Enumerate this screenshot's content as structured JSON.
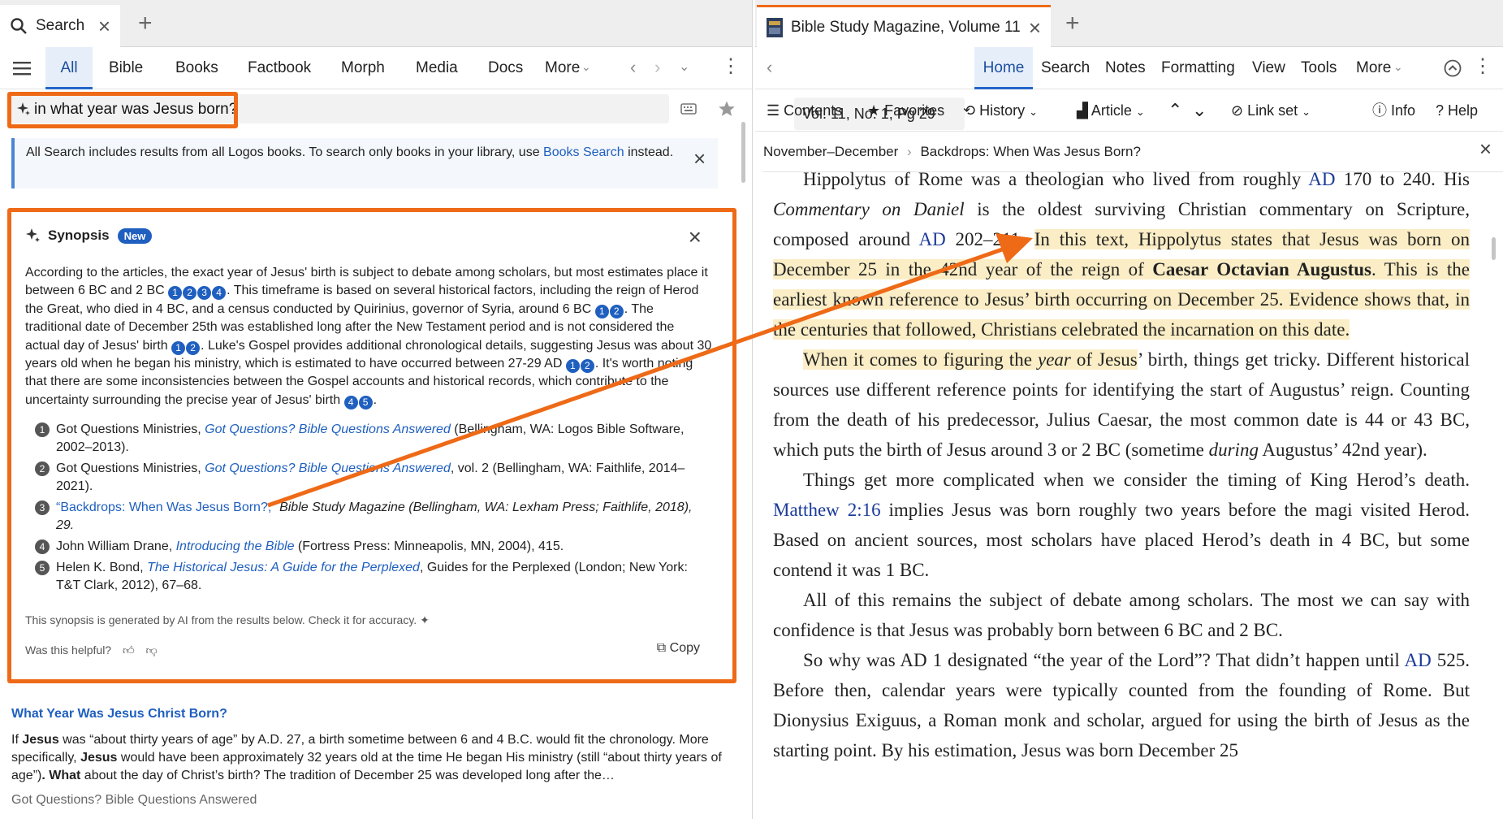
{
  "left": {
    "tab": {
      "label": "Search"
    },
    "nav": {
      "items": [
        "All",
        "Bible",
        "Books",
        "Factbook",
        "Morph",
        "Media",
        "Docs",
        "More"
      ]
    },
    "query": "in what year was Jesus born?",
    "info": {
      "text": "All Search includes results from all Logos books. To search only books in your library, use ",
      "link": "Books Search",
      "tail": " instead."
    },
    "synopsis": {
      "title": "Synopsis",
      "badge": "New",
      "p1": "According to the articles, the exact year of Jesus' birth is subject to debate among scholars, but most estimates place it between 6 BC and 2 BC",
      "p2": ". This timeframe is based on several historical factors, including the reign of Herod the Great, who died in 4 BC, and a census conducted by Quirinius, governor of Syria, around 6 BC",
      "p3": ". The traditional date of December 25th was established long after the New Testament period and is not considered the actual day of Jesus' birth",
      "p4": ". Luke's Gospel provides additional chronological details, suggesting Jesus was about 30 years old when he began his ministry, which is estimated to have occurred between 27-29 AD",
      "p5": ". It's worth noting that there are some inconsistencies between the Gospel accounts and historical records, which contribute to the uncertainty surrounding the precise year of Jesus' birth",
      "p6": ".",
      "cites": {
        "c1": "1",
        "c2": "2",
        "c3": "3",
        "c4": "4",
        "c5": "5"
      },
      "refs": [
        {
          "num": "1",
          "pre": "Got Questions Ministries, ",
          "title": "Got Questions? Bible Questions Answered",
          "post": " (Bellingham, WA: Logos Bible Software, 2002–2013)."
        },
        {
          "num": "2",
          "pre": "Got Questions Ministries, ",
          "title": "Got Questions? Bible Questions Answered",
          "post": ", vol. 2 (Bellingham, WA: Faithlife, 2014–2021)."
        },
        {
          "num": "3",
          "pre": "",
          "title": "“Backdrops: When Was Jesus Born?,”",
          "post": " Bible Study Magazine (Bellingham, WA: Lexham Press; Faithlife, 2018), 29."
        },
        {
          "num": "4",
          "pre": "John William Drane, ",
          "title": "Introducing the Bible",
          "post": " (Fortress Press: Minneapolis, MN, 2004), 415."
        },
        {
          "num": "5",
          "pre": "Helen K. Bond, ",
          "title": "The Historical Jesus: A Guide for the Perplexed",
          "post": ", Guides for the Perplexed (London; New York: T&T Clark, 2012), 67–68."
        }
      ],
      "disclaimer": "This synopsis is generated by AI from the results below. Check it for accuracy.",
      "helpful": "Was this helpful?",
      "copy": "Copy"
    },
    "result": {
      "title": "What Year Was Jesus Christ Born?",
      "s1": "If ",
      "b1": "Jesus",
      "s2": " was “about thirty years of age” by A.D. 27, a birth sometime between 6 and 4 B.C. would fit the chronology. More specifically, ",
      "b2": "Jesus",
      "s3": " would have been approximately 32 years old at the time He began His ministry (still “about thirty years of age”)",
      "b3": ". What",
      "s4": " about the day of Christ’s birth? The tradition of December 25 was developed long after the…",
      "source": "Got Questions? Bible Questions Answered"
    }
  },
  "right": {
    "tab": {
      "label": "Bible Study Magazine, Volume 11"
    },
    "address": "Vol. 11, No. 1, Pg 29",
    "nav": {
      "items": [
        "Home",
        "Search",
        "Notes",
        "Formatting",
        "View",
        "Tools",
        "More"
      ]
    },
    "tools": {
      "contents": "Contents",
      "favorites": "Favorites",
      "history": "History",
      "article": "Article",
      "linkset": "Link set",
      "info": "Info",
      "help": "Help"
    },
    "breadcrumb": {
      "a": "November–December",
      "b": "Backdrops: When Was Jesus Born?"
    },
    "article": {
      "p1a": "Hippolytus of Rome was a theologian who lived from roughly ",
      "p1ad": "AD",
      "p1b": " 170 to 240. His ",
      "p1i": "Commentary on Daniel",
      "p1c": " is the oldest surviving Christian commentary on Scripture, composed around ",
      "p1ad2": "AD",
      "p1d": " 202–211. ",
      "p1h1": "In this text, Hippolytus states that Jesus was born on December 25 in the 42nd year of the reign of ",
      "p1hb": "Caesar Octavian Augustus",
      "p1h2": ". This is the earliest known reference to Jesus’ birth occurring on December 25. Evidence shows that, in the centuries that followed, Christians celebrated the incarnation on this date.",
      "p2h1": "When it comes to figuring the ",
      "p2hi": "year",
      "p2h2": " of Jesus",
      "p2a": "’ birth, things get tricky. Different historical sources use different reference points for identifying the start of Augus­tus’ reign. Counting from the death of his predecessor, Julius Caesar, the most common date is 44 or 43 BC, which puts the birth of Jesus around 3 or 2 BC (some­time ",
      "p2i": "during",
      "p2b": " Augustus’ 42nd year).",
      "p3a": "Things get more complicated when we consider the timing of King Herod’s death. ",
      "p3l": "Matthew 2:16",
      "p3b": " implies Jesus was born roughly two years before the magi vis­ited Herod. Based on ancient sources, most scholars have placed Herod’s death in 4 BC, but some contend it was 1 BC.",
      "p4": "All of this remains the subject of debate among scholars. The most we can say with confidence is that Jesus was probably born between 6 BC and 2 BC.",
      "p5a": "So why was AD 1 designated “the year of the Lord”? That didn’t happen until ",
      "p5ad": "AD",
      "p5b": " 525. Before then, calendar years were typically counted from the founding of Rome. But Dionysius Exiguus, a Roman monk and scholar, argued for using the birth of Jesus as the starting point. By his estimation, Jesus was born December 25"
    }
  },
  "colors": {
    "accent": "#ee6a17",
    "link": "#1f5fbf",
    "highlight": "#fbeec6"
  }
}
